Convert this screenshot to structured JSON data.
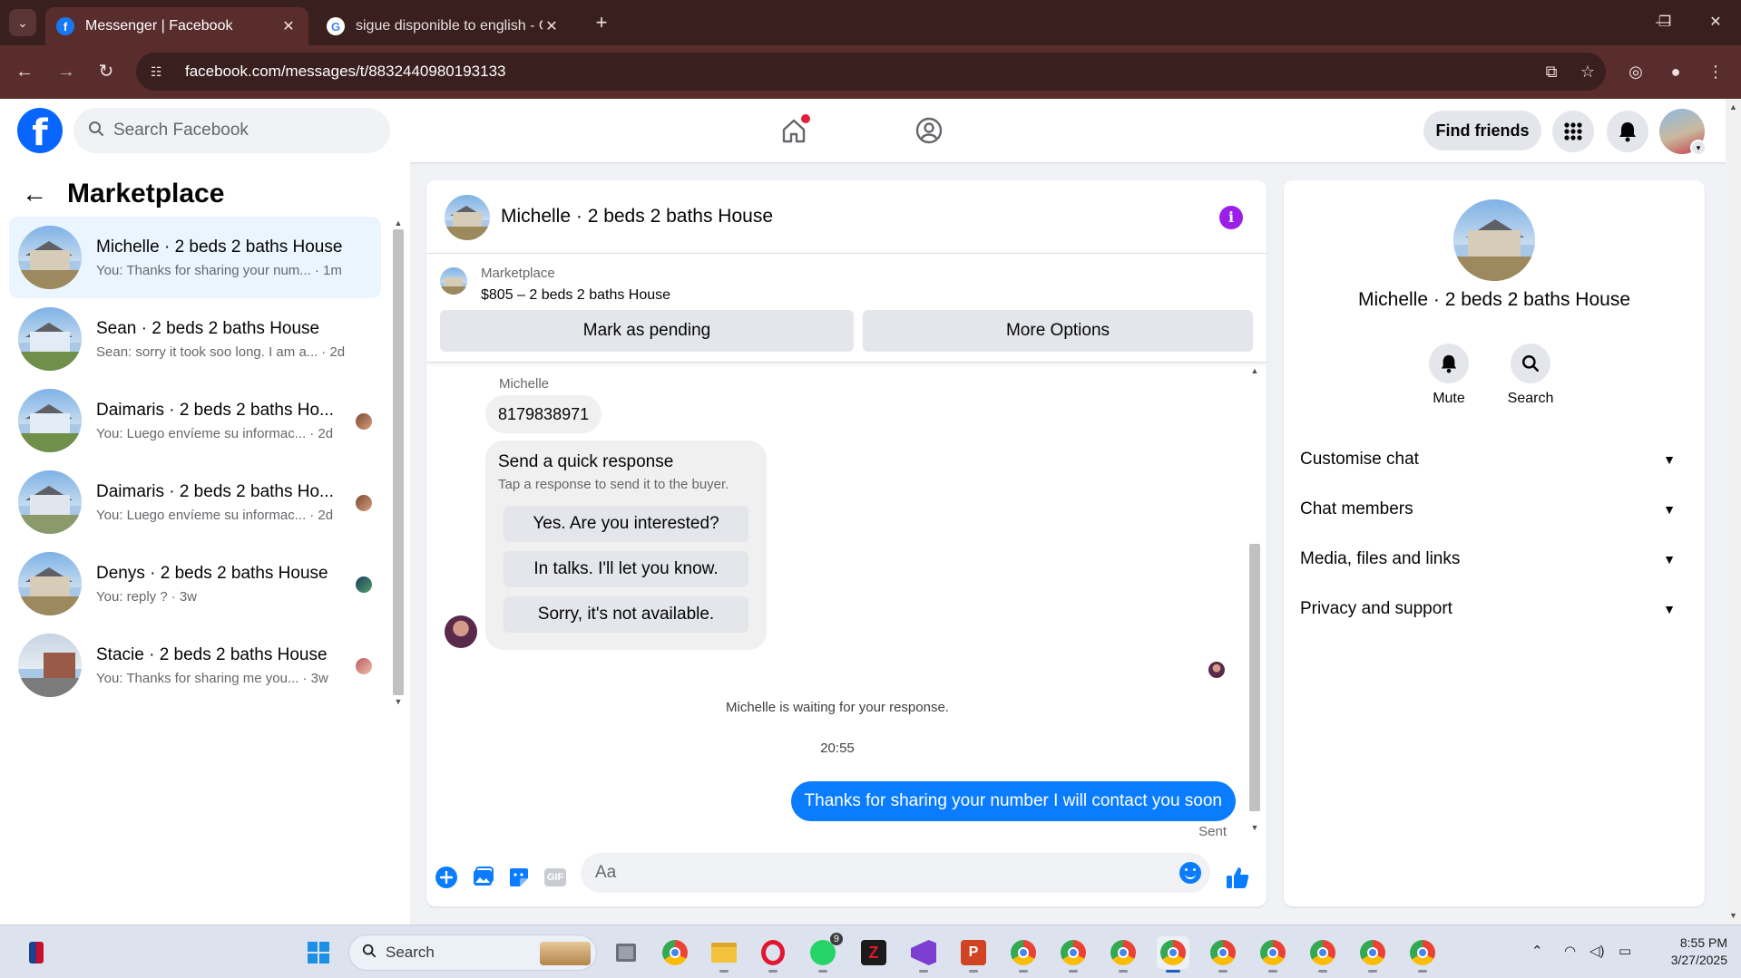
{
  "browser": {
    "tabs": [
      {
        "title": "Messenger | Facebook",
        "active": true
      },
      {
        "title": "sigue disponible to english - Go",
        "active": false
      }
    ],
    "url": "facebook.com/messages/t/8832440980193133"
  },
  "fb_header": {
    "search_placeholder": "Search Facebook",
    "find_friends_label": "Find friends"
  },
  "sidebar": {
    "title": "Marketplace",
    "conversations": [
      {
        "name": "Michelle · 2 beds 2 baths House",
        "preview": "You: Thanks for sharing your num...",
        "time": "· 1m",
        "active": true
      },
      {
        "name": "Sean · 2 beds 2 baths House",
        "preview": "Sean: sorry it took soo long. I am a...",
        "time": "· 2d",
        "active": false
      },
      {
        "name": "Daimaris · 2 beds 2 baths Ho...",
        "preview": "You: Luego envíeme su informac...",
        "time": "· 2d",
        "active": false
      },
      {
        "name": "Daimaris · 2 beds 2 baths Ho...",
        "preview": "You: Luego envíeme su informac...",
        "time": "· 2d",
        "active": false
      },
      {
        "name": "Denys · 2 beds 2 baths House",
        "preview": "You: reply ?",
        "time": "· 3w",
        "active": false
      },
      {
        "name": "Stacie · 2 beds 2 baths House",
        "preview": "You: Thanks for sharing me you...",
        "time": "· 3w",
        "active": false
      }
    ]
  },
  "chat": {
    "title": "Michelle · 2 beds 2 baths House",
    "listing": {
      "source": "Marketplace",
      "price_title": "$805 – 2 beds 2 baths House",
      "mark_pending_label": "Mark as pending",
      "more_options_label": "More Options"
    },
    "sender_name": "Michelle",
    "incoming_message": "8179838971",
    "quick_response": {
      "title": "Send a quick response",
      "subtitle": "Tap a response to send it to the buyer.",
      "options": [
        "Yes. Are you interested?",
        "In talks. I'll let you know.",
        "Sorry, it's not available."
      ]
    },
    "waiting_text": "Michelle is waiting for your response.",
    "timestamp": "20:55",
    "outgoing_message": "Thanks for sharing your number I will contact you soon",
    "sent_status": "Sent",
    "composer_placeholder": "Aa",
    "gif_label": "GIF"
  },
  "info_panel": {
    "name": "Michelle · 2 beds 2 baths House",
    "actions": [
      {
        "label": "Mute",
        "icon": "bell-icon"
      },
      {
        "label": "Search",
        "icon": "search-icon"
      }
    ],
    "sections": [
      "Customise chat",
      "Chat members",
      "Media, files and links",
      "Privacy and support"
    ]
  },
  "taskbar": {
    "search_label": "Search",
    "whatsapp_badge": "9",
    "time": "8:55 PM",
    "date": "3/27/2025"
  },
  "colors": {
    "fb_blue": "#0866ff",
    "bubble_blue": "#0a7cff",
    "info_purple": "#9b1fe8",
    "chrome_frame": "#5a2d2d"
  }
}
